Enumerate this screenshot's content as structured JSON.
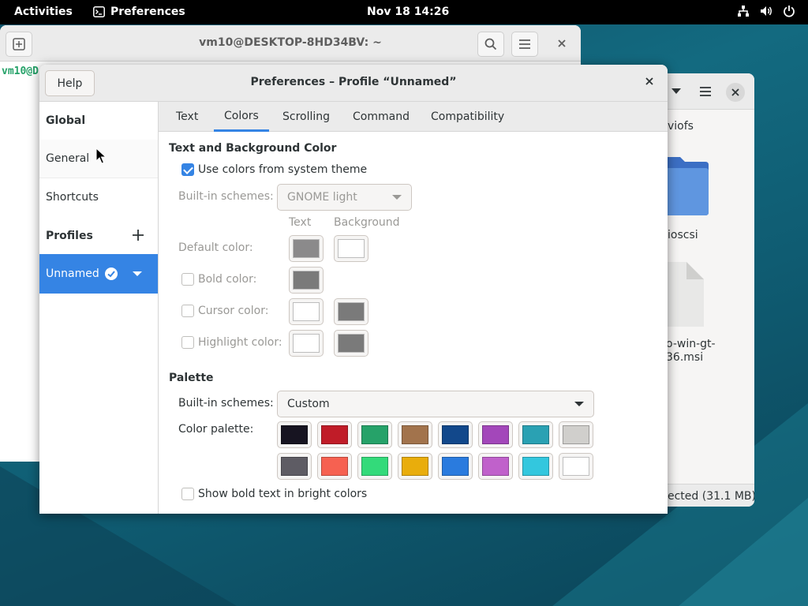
{
  "topbar": {
    "activities": "Activities",
    "app_name": "Preferences",
    "clock": "Nov 18  14:26"
  },
  "terminal": {
    "title": "vm10@DESKTOP-8HD34BV: ~",
    "prompt": "vm10@D"
  },
  "files_window": {
    "item1": "viofs",
    "item2": "ioscsi",
    "item3_line1": "o-win-gt-",
    "item3_line2": "36.msi",
    "status": "ected  (31.1 MB)"
  },
  "prefs": {
    "title": "Preferences – Profile “Unnamed”",
    "help_label": "Help",
    "sidebar": {
      "global_heading": "Global",
      "general": "General",
      "shortcuts": "Shortcuts",
      "profiles_heading": "Profiles",
      "profile_selected": "Unnamed"
    },
    "tabs": [
      "Text",
      "Colors",
      "Scrolling",
      "Command",
      "Compatibility"
    ],
    "active_tab": "Colors",
    "text_bg": {
      "section_title": "Text and Background Color",
      "use_system_label": "Use colors from system theme",
      "use_system_checked": true,
      "builtin_label": "Built-in schemes:",
      "builtin_value": "GNOME light",
      "col_text": "Text",
      "col_background": "Background",
      "default_label": "Default color:",
      "bold_label": "Bold color:",
      "cursor_label": "Cursor color:",
      "highlight_label": "Highlight color:",
      "default_text_color": "#8b8a8b",
      "default_bg_color": "#ffffff",
      "bold_color": "#7a7a7a",
      "cursor_text_color": "#ffffff",
      "cursor_bg_color": "#7a7a7a",
      "highlight_text_color": "#ffffff",
      "highlight_bg_color": "#7a7a7a"
    },
    "palette": {
      "section_title": "Palette",
      "builtin_label": "Built-in schemes:",
      "builtin_value": "Custom",
      "color_palette_label": "Color palette:",
      "row1": [
        "#171421",
        "#c01c28",
        "#26a269",
        "#a2734c",
        "#12488b",
        "#a347ba",
        "#2aa1b3",
        "#d0cfcc"
      ],
      "row2": [
        "#5e5c64",
        "#f66151",
        "#33da7a",
        "#e9ad0c",
        "#2a7bde",
        "#c061cb",
        "#33c7de",
        "#ffffff"
      ],
      "bright_bold_label": "Show bold text in bright colors",
      "bright_bold_checked": false
    }
  }
}
